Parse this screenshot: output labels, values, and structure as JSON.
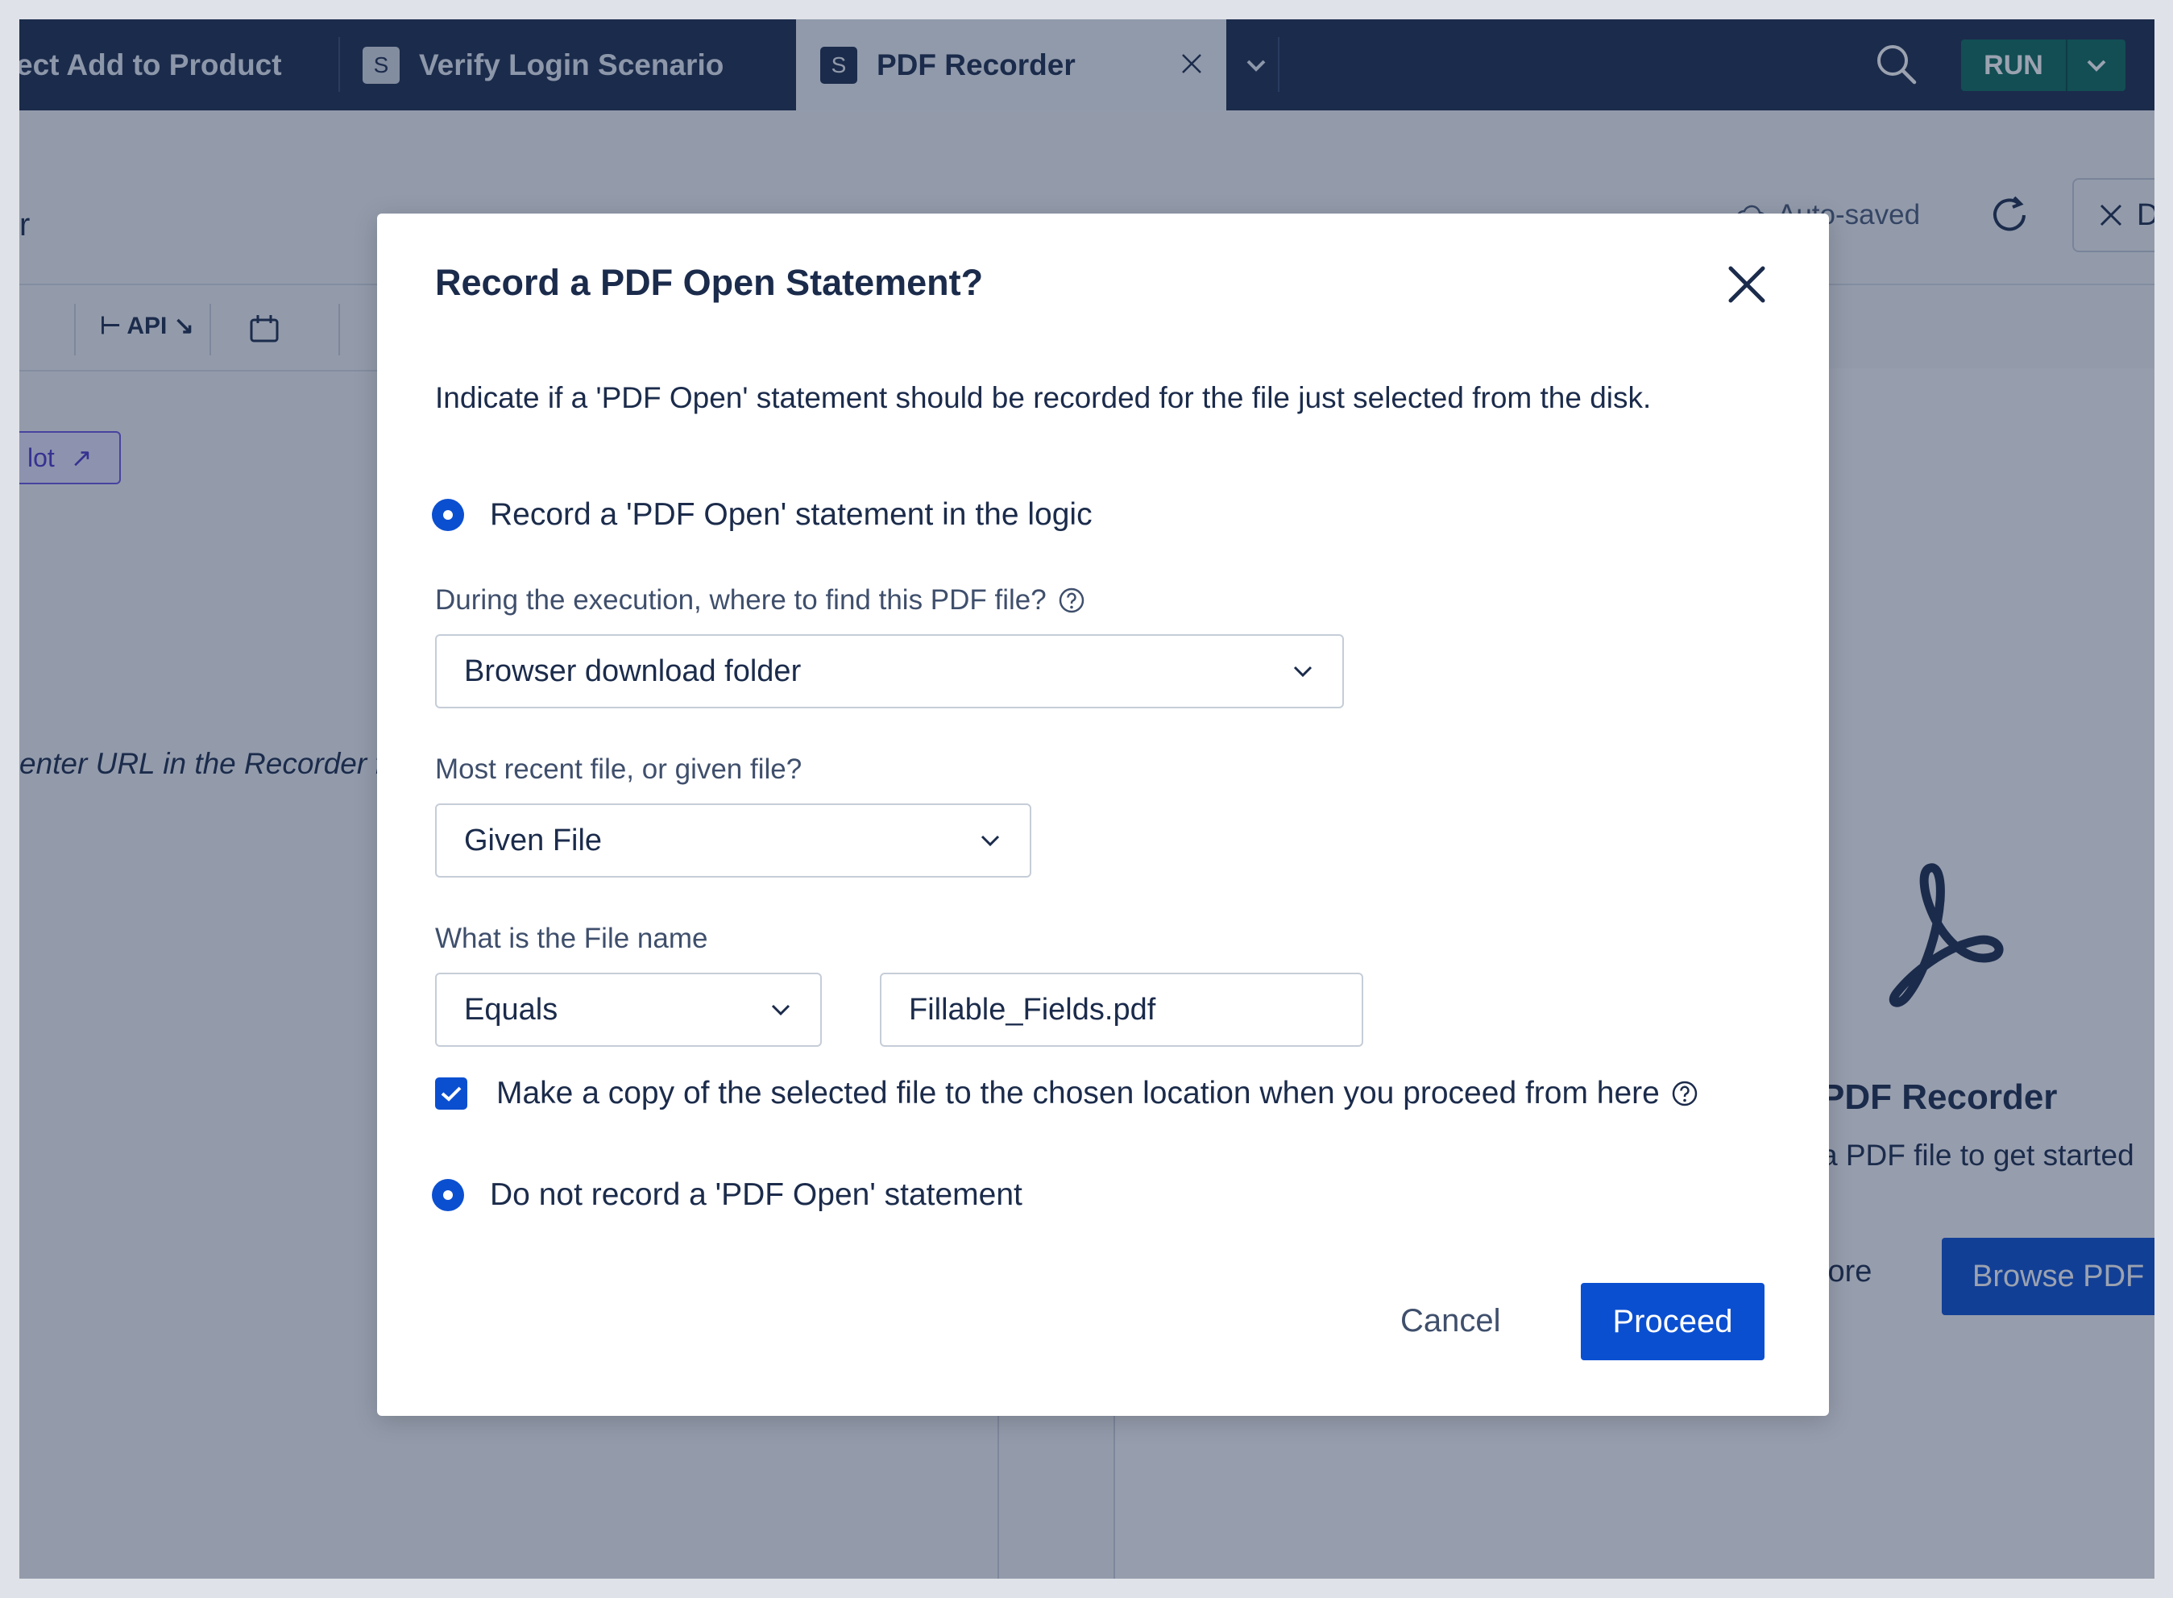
{
  "tabs": [
    {
      "label": "ect Add to Product",
      "badge": ""
    },
    {
      "label": "Verify Login Scenario",
      "badge": "S"
    },
    {
      "label": "PDF Recorder",
      "badge": "S",
      "active": true
    }
  ],
  "toolbar": {
    "run_label": "RUN"
  },
  "background": {
    "title_fragment": "r",
    "autosave_label": "Auto-saved",
    "close_fragment": "D",
    "api_label": "API",
    "pilot_label": "lot",
    "url_hint": "enter URL in the Recorder fo",
    "pdf_recorder_title": "PDF Recorder",
    "pdf_recorder_sub": "a PDF file to get started",
    "more_label": "lore",
    "browse_label": "Browse PDF"
  },
  "dialog": {
    "title": "Record a PDF Open Statement?",
    "description": "Indicate if a 'PDF Open' statement should be recorded for the file just selected from the disk.",
    "option_record": "Record a 'PDF Open' statement in the logic",
    "location_label": "During the execution, where to find this PDF file?",
    "location_value": "Browser download folder",
    "file_mode_label": "Most recent file, or given file?",
    "file_mode_value": "Given File",
    "file_name_label": "What is the File name",
    "match_value": "Equals",
    "file_name_value": "Fillable_Fields.pdf",
    "copy_label": "Make a copy of the selected file to the chosen location when you proceed from here",
    "option_no_record": "Do not record a 'PDF Open' statement",
    "cancel_label": "Cancel",
    "proceed_label": "Proceed"
  },
  "colors": {
    "nav": "#1b2b4b",
    "primary": "#0b4fd1",
    "run": "#0b6a5c"
  }
}
